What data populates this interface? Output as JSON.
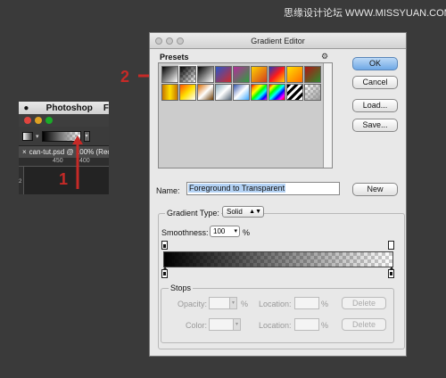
{
  "watermark": "思缘设计论坛  WWW.MISSYUAN.COM",
  "photoshop": {
    "menubar": {
      "apple": "",
      "app_name": "Photoshop",
      "next_menu": "F"
    },
    "doc_tab": {
      "close": "×",
      "title": "can-tut.psd @ 100% (Rect"
    },
    "ruler": {
      "mark1": "450",
      "mark2": "400",
      "vmark": "2"
    }
  },
  "annotations": {
    "label1": "1",
    "label2": "2",
    "accent_color": "#c62a27"
  },
  "dialog": {
    "title": "Gradient Editor",
    "presets_label": "Presets",
    "gear_icon": "⚙",
    "presets": [
      {
        "style": "linear-gradient(135deg,#000,#fff)"
      },
      {
        "style": "linear-gradient(135deg,#000,transparent),repeating-conic-gradient(#bbb 0 25%,#fff 0 50%) 0 0/6px 6px"
      },
      {
        "style": "linear-gradient(135deg,#000,#fff)"
      },
      {
        "style": "linear-gradient(135deg,#2a56c8,#cf2b2b)"
      },
      {
        "style": "linear-gradient(135deg,#b52c9a,#2e9e3e)"
      },
      {
        "style": "linear-gradient(135deg,#ffd200,#d23d1f)"
      },
      {
        "style": "linear-gradient(135deg,#2439b8,#ff1a1a,#ffd400)"
      },
      {
        "style": "linear-gradient(135deg,#ffe100,#ff6a00)"
      },
      {
        "style": "linear-gradient(135deg,#b01515,#2e8a2e)"
      },
      {
        "style": "linear-gradient(90deg,#c77500,#ffe000,#c77500)"
      },
      {
        "style": "linear-gradient(135deg,#ff5000,#ffe000,#fff)"
      },
      {
        "style": "linear-gradient(135deg,#d86a00,#fff,#6a3a00)"
      },
      {
        "style": "linear-gradient(135deg,#8ab,#fff,#567)"
      },
      {
        "style": "linear-gradient(135deg,#35a,#fff,#3aa6ff)"
      },
      {
        "style": "linear-gradient(135deg,red,orange,yellow,lime,cyan,blue,magenta)"
      },
      {
        "style": "linear-gradient(135deg,red,yellow,lime,cyan,blue,magenta,red)"
      },
      {
        "style": "repeating-linear-gradient(135deg,#000 0 3px,#fff 3px 6px)"
      },
      {
        "style": "linear-gradient(135deg,transparent,#999),repeating-conic-gradient(#bbb 0 25%,#fff 0 50%) 0 0/6px 6px"
      }
    ],
    "buttons": {
      "ok": "OK",
      "cancel": "Cancel",
      "load": "Load...",
      "save": "Save..."
    },
    "name_label": "Name:",
    "name_value": "Foreground to Transparent",
    "new_button": "New",
    "gradient_type_label": "Gradient Type:",
    "gradient_type_value": "Solid",
    "select_arrow": "▲▼",
    "smoothness_label": "Smoothness:",
    "smoothness_value": "100",
    "smoothness_unit": "%",
    "stops": {
      "label": "Stops",
      "opacity_label": "Opacity:",
      "opacity_unit": "%",
      "location_label": "Location:",
      "location_unit": "%",
      "delete": "Delete",
      "color_label": "Color:"
    }
  }
}
